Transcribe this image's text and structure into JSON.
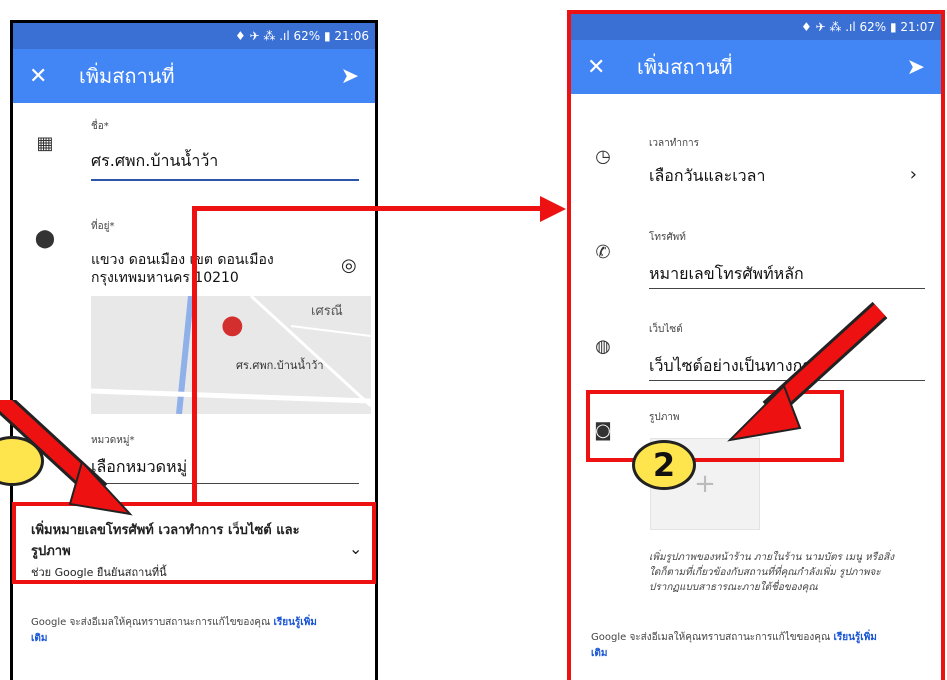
{
  "phone1": {
    "status": "♦ ✈ ⁂ .ıl 62% ▮ 21:06",
    "title": "เพิ่มสถานที่",
    "name_label": "ชื่อ*",
    "name_value": "ศร.ศพก.บ้านน้ำว้า",
    "address_label": "ที่อยู่*",
    "address_line1": "แขวง ดอนเมือง เขต ดอนเมือง",
    "address_line2": "กรุงเทพมหานคร 10210",
    "map_area_label": "เศรณี",
    "map_pin_label": "ศร.ศพก.บ้านน้ำว้า",
    "category_label": "หมวดหมู่*",
    "category_value": "เลือกหมวดหมู่",
    "expand_title_1": "เพิ่มหมายเลขโทรศัพท์ เวลาทำการ เว็บไซต์ และ",
    "expand_title_2": "รูปภาพ",
    "expand_subtitle": "ช่วย Google ยืนยันสถานที่นี้",
    "footer_text": "Google จะส่งอีเมลให้คุณทราบสถานะการแก้ไขของคุณ",
    "footer_link_1": "เรียนรู้เพิ่ม",
    "footer_link_2": "เติม"
  },
  "phone2": {
    "status": "♦ ✈ ⁂ .ıl 62% ▮ 21:07",
    "title": "เพิ่มสถานที่",
    "hours_label": "เวลาทำการ",
    "hours_value": "เลือกวันและเวลา",
    "phone_label": "โทรศัพท์",
    "phone_value": "หมายเลขโทรศัพท์หลัก",
    "website_label": "เว็บไซต์",
    "website_value": "เว็บไซต์อย่างเป็นทางการ",
    "photo_label": "รูปภาพ",
    "photo_desc_1": "เพิ่มรูปภาพของหน้าร้าน ภายในร้าน นามบัตร เมนู หรือสิ่ง",
    "photo_desc_2": "ใดก็ตามที่เกี่ยวข้องกับสถานที่ที่คุณกำลังเพิ่ม รูปภาพจะ",
    "photo_desc_3": "ปรากฏแบบสาธารณะภายใต้ชื่อของคุณ",
    "footer_text": "Google จะส่งอีเมลให้คุณทราบสถานะการแก้ไขของคุณ",
    "footer_link_1": "เรียนรู้เพิ่ม",
    "footer_link_2": "เติม"
  },
  "badges": {
    "two": "2"
  },
  "colors": {
    "appbar": "#4285f4",
    "statusbar": "#3a6fd3",
    "annotation_red": "#e11111",
    "badge": "#ffe54d"
  }
}
